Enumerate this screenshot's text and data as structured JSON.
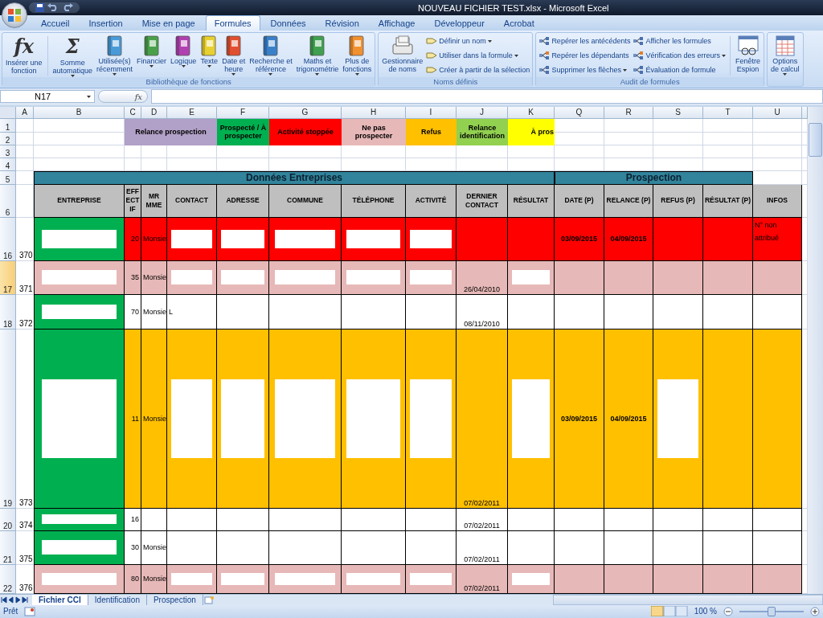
{
  "window": {
    "title": "NOUVEAU FICHIER TEST.xlsx - Microsoft Excel"
  },
  "ribbon_tabs": [
    {
      "label": "Accueil",
      "selected": false
    },
    {
      "label": "Insertion",
      "selected": false
    },
    {
      "label": "Mise en page",
      "selected": false
    },
    {
      "label": "Formules",
      "selected": true
    },
    {
      "label": "Données",
      "selected": false
    },
    {
      "label": "Révision",
      "selected": false
    },
    {
      "label": "Affichage",
      "selected": false
    },
    {
      "label": "Développeur",
      "selected": false
    },
    {
      "label": "Acrobat",
      "selected": false
    }
  ],
  "ribbon_groups": [
    {
      "label": "Bibliothèque de fonctions",
      "large": [
        {
          "label": "Insérer une\nfonction",
          "glyph": "fx",
          "menu": false
        },
        {
          "label": "Somme\nautomatique",
          "glyph": "Σ",
          "menu": true
        },
        {
          "label": "Utilisée(s)\nrécemment",
          "color": "#4a9ad8",
          "menu": true
        },
        {
          "label": "Financier\n",
          "color": "#4aa04a",
          "menu": true
        },
        {
          "label": "Logique\n",
          "color": "#b040b0",
          "menu": true
        },
        {
          "label": "Texte\n",
          "color": "#e8d030",
          "menu": true
        },
        {
          "label": "Date et\nheure",
          "color": "#e05030",
          "menu": true
        },
        {
          "label": "Recherche et\nréférence",
          "color": "#3a80c8",
          "menu": true
        },
        {
          "label": "Maths et\ntrigonométrie",
          "color": "#40a050",
          "menu": true
        },
        {
          "label": "Plus de\nfonctions",
          "color": "#f09030",
          "menu": true
        }
      ]
    },
    {
      "label": "Noms définis",
      "large": [
        {
          "label": "Gestionnaire\nde noms",
          "menu": false
        }
      ],
      "small": [
        {
          "label": "Définir un nom",
          "menu": true
        },
        {
          "label": "Utiliser dans la formule",
          "menu": true
        },
        {
          "label": "Créer à partir de la sélection",
          "menu": false
        }
      ]
    },
    {
      "label": "Audit de formules",
      "small": [
        {
          "label": "Repérer les antécédents",
          "menu": false
        },
        {
          "label": "Repérer les dépendants",
          "menu": false
        },
        {
          "label": "Supprimer les flèches",
          "menu": true
        },
        {
          "label": "Afficher les formules",
          "menu": false
        },
        {
          "label": "Vérification des erreurs",
          "menu": true
        },
        {
          "label": "Évaluation de formule",
          "menu": false
        }
      ],
      "trailing": [
        {
          "label": "Fenêtre\nEspion",
          "menu": false
        }
      ]
    },
    {
      "large": [
        {
          "label": "Options\nde calcul",
          "menu": true
        }
      ]
    }
  ],
  "formula_bar": {
    "name_box": "N17",
    "fx_label": "fx"
  },
  "columns": [
    "A",
    "B",
    "C",
    "D",
    "E",
    "F",
    "G",
    "H",
    "I",
    "J",
    "K",
    "Q",
    "R",
    "S",
    "T",
    "U"
  ],
  "row_headers": [
    {
      "label": "1",
      "selected": false
    },
    {
      "label": "2",
      "selected": false
    },
    {
      "label": "3",
      "selected": false
    },
    {
      "label": "4",
      "selected": false
    },
    {
      "label": "5",
      "selected": false
    },
    {
      "label": "6",
      "selected": false
    },
    {
      "label": "16",
      "selected": false
    },
    {
      "label": "17",
      "selected": true
    },
    {
      "label": "18",
      "selected": false
    },
    {
      "label": "19",
      "selected": false
    },
    {
      "label": "20",
      "selected": false
    },
    {
      "label": "21",
      "selected": false
    },
    {
      "label": "22",
      "selected": false
    }
  ],
  "legend": [
    {
      "label": "Relance prospection",
      "color": "#b1a0c7"
    },
    {
      "label": "Prospecté / À prospecter",
      "color": "#00b050"
    },
    {
      "label": "Activité stoppée",
      "color": "#ff0000"
    },
    {
      "label": "Ne pas prospecter",
      "color": "#e6b8b7"
    },
    {
      "label": "Refus",
      "color": "#ffc000"
    },
    {
      "label": "Relance identification",
      "color": "#92d050"
    },
    {
      "label": "À pros",
      "color": "#ffff00"
    }
  ],
  "sections": [
    {
      "title": "Données Entreprises"
    },
    {
      "title": "Prospection"
    }
  ],
  "headers": [
    "ENTREPRISE",
    "EFFECTIF",
    "MR MME",
    "CONTACT",
    "ADRESSE",
    "COMMUNE",
    "TÉLÉPHONE",
    "ACTIVITÉ",
    "DERNIER CONTACT",
    "RÉSULTAT",
    "DATE (P)",
    "RELANCE (P)",
    "REFUS (P)",
    "RÉSULTAT (P)",
    "INFOS"
  ],
  "rows": [
    {
      "number": "370",
      "color": "#ff0000",
      "cells": [
        {
          "kind": "redacted",
          "color": "#00b050"
        },
        {
          "kind": "text",
          "text": "20"
        },
        {
          "kind": "text",
          "text": "Monsie"
        },
        {
          "kind": "redacted"
        },
        {
          "kind": "redacted"
        },
        {
          "kind": "redacted"
        },
        {
          "kind": "redacted"
        },
        {
          "kind": "redacted"
        },
        {
          "kind": "empty"
        },
        {
          "kind": "empty"
        },
        {
          "kind": "text",
          "text": "03/09/2015"
        },
        {
          "kind": "text",
          "text": "04/09/2015"
        },
        {
          "kind": "empty"
        },
        {
          "kind": "empty"
        },
        {
          "kind": "text",
          "text": "N° non attribué"
        }
      ]
    },
    {
      "number": "371",
      "color": "#e6b8b7",
      "cells": [
        {
          "kind": "redacted"
        },
        {
          "kind": "text",
          "text": "35"
        },
        {
          "kind": "text",
          "text": "Monsie"
        },
        {
          "kind": "redacted"
        },
        {
          "kind": "redacted"
        },
        {
          "kind": "redacted"
        },
        {
          "kind": "redacted"
        },
        {
          "kind": "redacted"
        },
        {
          "kind": "text",
          "text": "26/04/2010"
        },
        {
          "kind": "redacted"
        },
        {
          "kind": "empty"
        },
        {
          "kind": "empty"
        },
        {
          "kind": "empty"
        },
        {
          "kind": "empty"
        },
        {
          "kind": "empty"
        }
      ]
    },
    {
      "number": "372",
      "color": "#ffffff",
      "cells": [
        {
          "kind": "redacted",
          "color": "#00b050"
        },
        {
          "kind": "text",
          "text": "70"
        },
        {
          "kind": "text",
          "text": "Monsie"
        },
        {
          "kind": "text",
          "text": "L"
        },
        {
          "kind": "empty"
        },
        {
          "kind": "empty"
        },
        {
          "kind": "empty"
        },
        {
          "kind": "empty"
        },
        {
          "kind": "text",
          "text": "08/11/2010"
        },
        {
          "kind": "empty"
        },
        {
          "kind": "empty"
        },
        {
          "kind": "empty"
        },
        {
          "kind": "empty"
        },
        {
          "kind": "empty"
        },
        {
          "kind": "empty"
        }
      ]
    },
    {
      "number": "373",
      "color": "#ffc000",
      "cells": [
        {
          "kind": "redacted",
          "color": "#00b050"
        },
        {
          "kind": "text",
          "text": "11"
        },
        {
          "kind": "text",
          "text": "Monsie"
        },
        {
          "kind": "redacted"
        },
        {
          "kind": "redacted"
        },
        {
          "kind": "redacted"
        },
        {
          "kind": "redacted"
        },
        {
          "kind": "redacted"
        },
        {
          "kind": "text",
          "text": "07/02/2011"
        },
        {
          "kind": "redacted"
        },
        {
          "kind": "text",
          "text": "03/09/2015"
        },
        {
          "kind": "text",
          "text": "04/09/2015"
        },
        {
          "kind": "redacted"
        },
        {
          "kind": "empty"
        },
        {
          "kind": "empty"
        }
      ]
    },
    {
      "number": "374",
      "color": "#ffffff",
      "cells": [
        {
          "kind": "redacted",
          "color": "#00b050"
        },
        {
          "kind": "text",
          "text": "16"
        },
        {
          "kind": "empty"
        },
        {
          "kind": "empty"
        },
        {
          "kind": "empty"
        },
        {
          "kind": "empty"
        },
        {
          "kind": "empty"
        },
        {
          "kind": "empty"
        },
        {
          "kind": "text",
          "text": "07/02/2011"
        },
        {
          "kind": "empty"
        },
        {
          "kind": "empty"
        },
        {
          "kind": "empty"
        },
        {
          "kind": "empty"
        },
        {
          "kind": "empty"
        },
        {
          "kind": "empty"
        }
      ]
    },
    {
      "number": "375",
      "color": "#ffffff",
      "cells": [
        {
          "kind": "redacted",
          "color": "#00b050"
        },
        {
          "kind": "text",
          "text": "30"
        },
        {
          "kind": "text",
          "text": "Monsie"
        },
        {
          "kind": "empty"
        },
        {
          "kind": "empty"
        },
        {
          "kind": "empty"
        },
        {
          "kind": "empty"
        },
        {
          "kind": "empty"
        },
        {
          "kind": "text",
          "text": "07/02/2011"
        },
        {
          "kind": "empty"
        },
        {
          "kind": "empty"
        },
        {
          "kind": "empty"
        },
        {
          "kind": "empty"
        },
        {
          "kind": "empty"
        },
        {
          "kind": "empty"
        }
      ]
    },
    {
      "number": "376",
      "color": "#e6b8b7",
      "cells": [
        {
          "kind": "redacted"
        },
        {
          "kind": "text",
          "text": "80"
        },
        {
          "kind": "text",
          "text": "Monsie"
        },
        {
          "kind": "redacted"
        },
        {
          "kind": "redacted"
        },
        {
          "kind": "redacted"
        },
        {
          "kind": "redacted"
        },
        {
          "kind": "redacted"
        },
        {
          "kind": "text",
          "text": "07/02/2011"
        },
        {
          "kind": "redacted"
        },
        {
          "kind": "empty"
        },
        {
          "kind": "empty"
        },
        {
          "kind": "empty"
        },
        {
          "kind": "empty"
        },
        {
          "kind": "empty"
        }
      ]
    }
  ],
  "sheet_tabs": [
    {
      "label": "Fichier CCI",
      "selected": true
    },
    {
      "label": "Identification",
      "selected": false
    },
    {
      "label": "Prospection",
      "selected": false
    }
  ],
  "status_bar": {
    "state": "Prêt",
    "zoom": "100 %",
    "zoom_level": {
      "level": 0.5
    }
  }
}
